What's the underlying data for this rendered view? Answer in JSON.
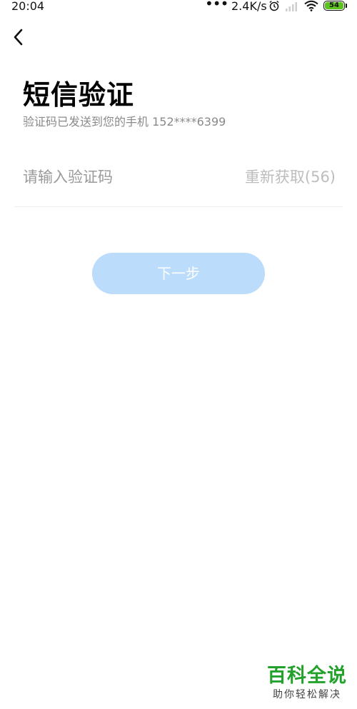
{
  "status_bar": {
    "time": "20:04",
    "dots": "•••",
    "speed": "2.4K/s",
    "battery": "54",
    "icons": [
      "alarm-icon",
      "signal-icon",
      "wifi-icon",
      "battery-icon"
    ]
  },
  "header": {
    "back_icon": "chevron-left-icon"
  },
  "main": {
    "title": "短信验证",
    "subtitle": "验证码已发送到您的手机 152****6399",
    "code_input": {
      "value": "",
      "placeholder": "请输入验证码"
    },
    "resend_label": "重新获取(56)",
    "next_label": "下一步"
  },
  "watermark": {
    "title": "百科全说",
    "subtitle": "助你轻松解决"
  },
  "colors": {
    "next_button_bg": "#bcdcfb",
    "resend_text": "#bdbdbd",
    "battery_fill": "#5ac31e",
    "watermark_green": "#22a12b"
  }
}
